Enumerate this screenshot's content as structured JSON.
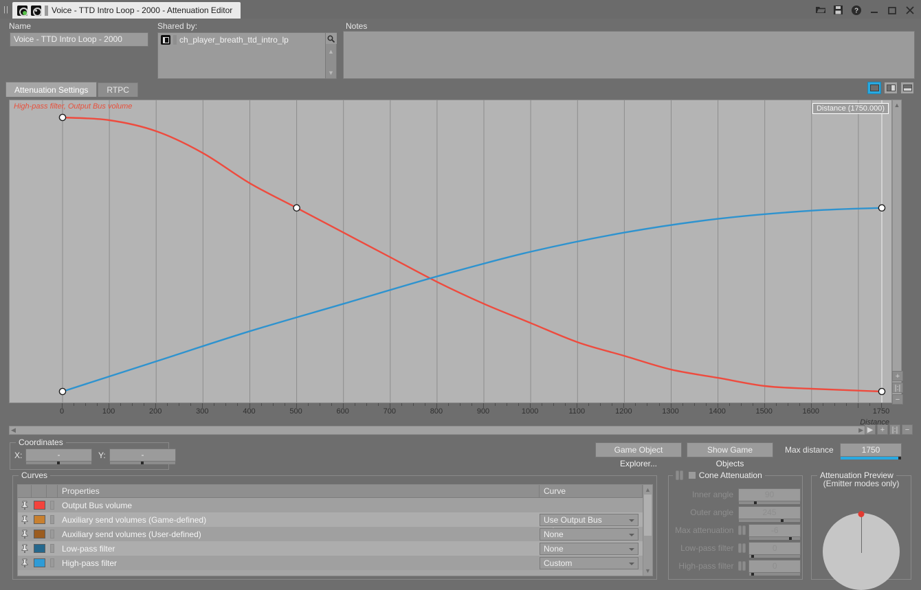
{
  "window": {
    "tab_title": "Voice - TTD Intro Loop - 2000 - Attenuation Editor",
    "icons": [
      "wwise-icon",
      "target-icon"
    ],
    "controls": [
      "open-icon",
      "save-icon",
      "help-icon",
      "minimize-icon",
      "maximize-icon",
      "close-icon"
    ]
  },
  "header": {
    "name_label": "Name",
    "name_value": "Voice - TTD Intro Loop - 2000",
    "shared_by_label": "Shared by:",
    "shared_by_items": [
      "ch_player_breath_ttd_intro_lp"
    ],
    "notes_label": "Notes",
    "notes_value": ""
  },
  "tabs": [
    {
      "label": "Attenuation Settings",
      "active": true
    },
    {
      "label": "RTPC",
      "active": false
    }
  ],
  "view_buttons": [
    {
      "name": "single-view",
      "selected": true
    },
    {
      "name": "split-vertical-view",
      "selected": false
    },
    {
      "name": "split-horizontal-view",
      "selected": false
    }
  ],
  "graph": {
    "curve_label": "High-pass filter, Output Bus volume",
    "tooltip": "Distance (1750.000)",
    "axis_label": "Distance",
    "x_ticks": [
      0,
      100,
      200,
      300,
      400,
      500,
      600,
      700,
      800,
      900,
      1000,
      1100,
      1200,
      1300,
      1400,
      1500,
      1600,
      1750
    ],
    "zoom_buttons": [
      "zoom-in",
      "zoom-fit",
      "zoom-out"
    ]
  },
  "chart_data": {
    "type": "line",
    "title": "High-pass filter, Output Bus volume",
    "xlabel": "Distance",
    "ylabel": "",
    "xlim": [
      0,
      1750
    ],
    "ylim": [
      0,
      100
    ],
    "grid": true,
    "series": [
      {
        "name": "Output Bus volume",
        "color": "#ee4b3e",
        "points": [
          {
            "x": 0,
            "y": 100
          },
          {
            "x": 100,
            "y": 99
          },
          {
            "x": 200,
            "y": 95
          },
          {
            "x": 300,
            "y": 87
          },
          {
            "x": 400,
            "y": 76
          },
          {
            "x": 500,
            "y": 67
          },
          {
            "x": 600,
            "y": 58
          },
          {
            "x": 700,
            "y": 49
          },
          {
            "x": 800,
            "y": 40
          },
          {
            "x": 900,
            "y": 32
          },
          {
            "x": 1000,
            "y": 25
          },
          {
            "x": 1100,
            "y": 18
          },
          {
            "x": 1200,
            "y": 13
          },
          {
            "x": 1300,
            "y": 8
          },
          {
            "x": 1400,
            "y": 5
          },
          {
            "x": 1500,
            "y": 2
          },
          {
            "x": 1600,
            "y": 1
          },
          {
            "x": 1750,
            "y": 0
          }
        ],
        "handles": [
          {
            "x": 0,
            "y": 100
          },
          {
            "x": 500,
            "y": 67
          },
          {
            "x": 1750,
            "y": 0
          }
        ]
      },
      {
        "name": "High-pass filter",
        "color": "#2e93cf",
        "points": [
          {
            "x": 0,
            "y": 0
          },
          {
            "x": 200,
            "y": 11
          },
          {
            "x": 400,
            "y": 22
          },
          {
            "x": 600,
            "y": 32
          },
          {
            "x": 800,
            "y": 42
          },
          {
            "x": 1000,
            "y": 51
          },
          {
            "x": 1200,
            "y": 58
          },
          {
            "x": 1400,
            "y": 63
          },
          {
            "x": 1600,
            "y": 66
          },
          {
            "x": 1750,
            "y": 67
          }
        ],
        "handles": [
          {
            "x": 0,
            "y": 0
          },
          {
            "x": 1750,
            "y": 67
          }
        ]
      }
    ]
  },
  "coordinates": {
    "group_label": "Coordinates",
    "x_label": "X:",
    "x_value": "-",
    "y_label": "Y:",
    "y_value": "-"
  },
  "toolbar": {
    "game_object_explorer": "Game Object Explorer...",
    "show_game_objects": "Show Game Objects",
    "max_distance_label": "Max distance",
    "max_distance_value": "1750"
  },
  "curves": {
    "group_label": "Curves",
    "columns": [
      "Properties",
      "Curve"
    ],
    "rows": [
      {
        "property": "Output Bus volume",
        "color": "#f4433c",
        "curve": "",
        "has_combo": false
      },
      {
        "property": "Auxiliary send volumes (Game-defined)",
        "color": "#c8802f",
        "curve": "Use Output Bus volume",
        "has_combo": true
      },
      {
        "property": "Auxiliary send volumes (User-defined)",
        "color": "#9b5c1f",
        "curve": "None",
        "has_combo": true
      },
      {
        "property": "Low-pass filter",
        "color": "#25688d",
        "curve": "None",
        "has_combo": true
      },
      {
        "property": "High-pass filter",
        "color": "#2e9bd6",
        "curve": "Custom",
        "has_combo": true
      }
    ]
  },
  "cone_attenuation": {
    "group_label": "Cone Attenuation",
    "enabled": false,
    "fields": [
      {
        "label": "Inner angle",
        "value": "90",
        "fill": 0.25,
        "has_lock": false
      },
      {
        "label": "Outer angle",
        "value": "245",
        "fill": 0.68,
        "has_lock": false
      },
      {
        "label": "Max attenuation",
        "value": "-6",
        "fill": 0.78,
        "has_lock": true
      },
      {
        "label": "Low-pass filter",
        "value": "0",
        "fill": 0.04,
        "has_lock": true
      },
      {
        "label": "High-pass filter",
        "value": "0",
        "fill": 0.04,
        "has_lock": true
      }
    ]
  },
  "attenuation_preview": {
    "title": "Attenuation Preview",
    "subtitle": "(Emitter modes only)"
  },
  "colors": {
    "accent": "#29a9e0",
    "curve_red": "#ee4b3e",
    "curve_blue": "#2e93cf",
    "panel_bg": "#6e6e6e",
    "plot_bg": "#b4b4b4"
  }
}
